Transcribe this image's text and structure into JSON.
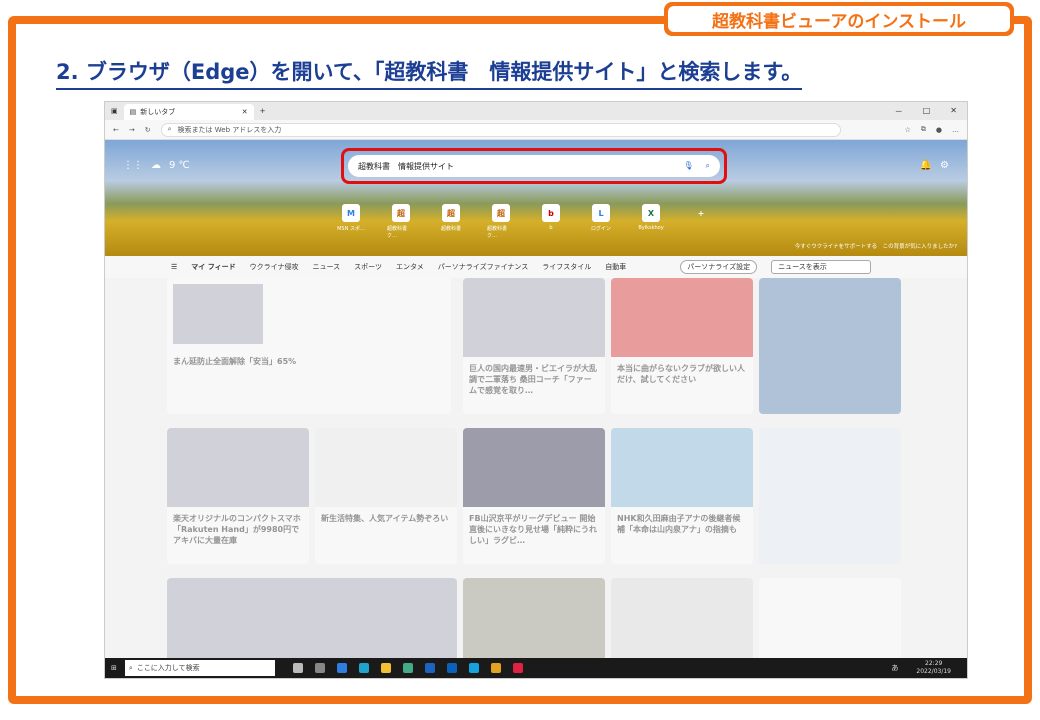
{
  "tag_label": "超教科書ビューアのインストール",
  "heading": "2. ブラウザ（Edge）を開いて、「超教科書　情報提供サイト」と検索します。",
  "browser": {
    "tab_title": "新しいタブ",
    "address_placeholder": "検索または Web アドレスを入力",
    "window_controls": [
      "－",
      "□",
      "✕"
    ]
  },
  "hero": {
    "temperature": "9 ℃",
    "search_value": "超教科書　情報提供サイト",
    "quick_links": [
      {
        "label": "MSN スポ…",
        "icon": "M"
      },
      {
        "label": "超教科書ク…",
        "icon": "超"
      },
      {
        "label": "超教科書",
        "icon": "超"
      },
      {
        "label": "超教科書ク…",
        "icon": "超"
      },
      {
        "label": "b",
        "icon": "b"
      },
      {
        "label": "ログイン",
        "icon": "L"
      },
      {
        "label": "Bylkskhoy",
        "icon": "X"
      }
    ],
    "footer_text": "今すぐウクライナをサポートする　この背景が気に入りましたか?"
  },
  "feed_nav": {
    "items": [
      "マイ フィード",
      "ウクライナ侵攻",
      "ニュース",
      "スポーツ",
      "エンタメ",
      "パーソナライズファイナンス",
      "ライフスタイル",
      "自動車"
    ],
    "personalize": "パーソナライズ設定",
    "view_select": "ニュースを表示"
  },
  "feed_cards": [
    "まん延防止全面解除「安当」65%",
    "巨人の国内最速男・ビエイラが大乱調で二軍落ち 桑田コーチ「ファームで感覚を取り…",
    "本当に曲がらないクラブが欲しい人だけ、試してください",
    "楽天オリジナルのコンパクトスマホ「Rakuten Hand」が9980円でアキバに大量在庫",
    "新生活特集、人気アイテム勢ぞろい",
    "FB山沢京平がリーグデビュー 開始直後にいきなり見せ場「純粋にうれしい」ラグビ…",
    "NHK和久田麻由子アナの後継者候補「本命は山内泉アナ」の指摘も"
  ],
  "taskbar": {
    "search_placeholder": "ここに入力して検索",
    "time": "22:29",
    "date": "2022/03/19",
    "ime": "あ"
  }
}
